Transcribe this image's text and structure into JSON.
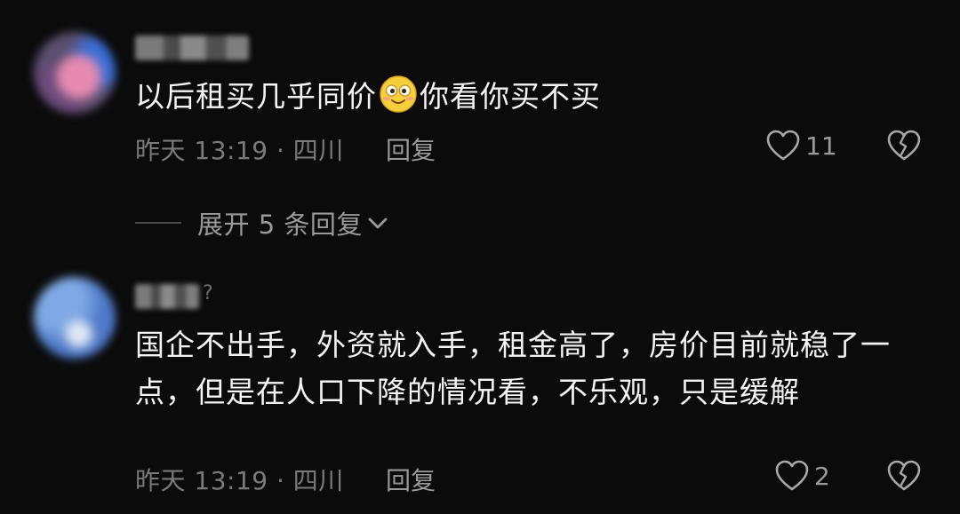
{
  "comments": [
    {
      "username_suffix": "",
      "text": "以后租买几乎同价",
      "text_after_emoji": "你看你买不买",
      "emoji": "smiling-face-emoji",
      "meta": "昨天 13:19 · 四川",
      "reply_label": "回复",
      "likes": "11"
    },
    {
      "username_suffix": "?",
      "text": "国企不出手，外资就入手，租金高了，房价目前就稳了一点，但是在人口下降的情况看，不乐观，只是缓解",
      "meta": "昨天 13:19 · 四川",
      "reply_label": "回复",
      "likes": "2"
    }
  ],
  "expand_replies": {
    "label": "展开 5 条回复",
    "icon": "chevron-down-icon"
  },
  "icons": {
    "like": "heart-outline-icon",
    "dislike": "broken-heart-icon"
  },
  "colors": {
    "background": "#0b0b0b",
    "text": "#f4f4f4",
    "secondary": "#7a7a7a",
    "emoji": "#f7cf3a"
  }
}
